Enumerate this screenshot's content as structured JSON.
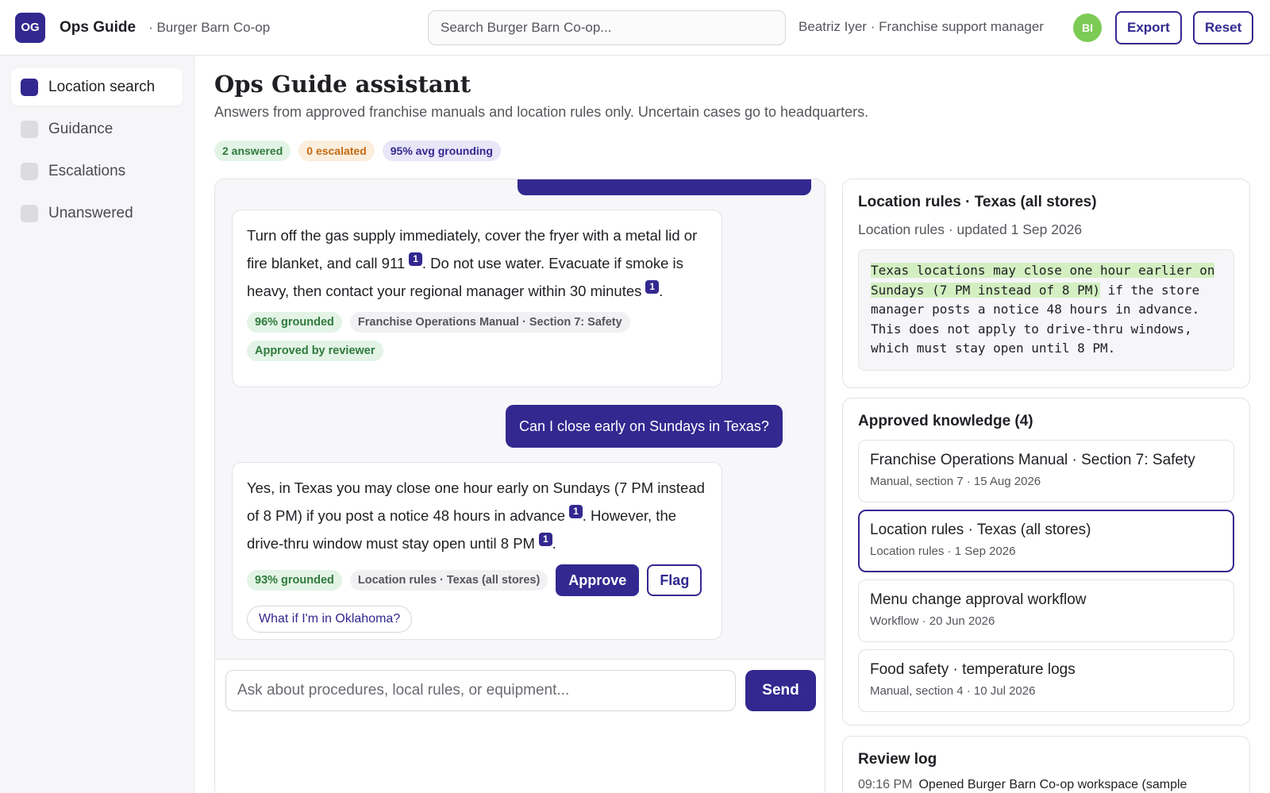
{
  "header": {
    "logo_text": "OG",
    "app_name": "Ops Guide",
    "org_name": "· Burger Barn Co-op",
    "search_placeholder": "Search Burger Barn Co-op...",
    "user_text": "Beatriz Iyer · Franchise support manager",
    "avatar_initials": "BI",
    "export_label": "Export",
    "reset_label": "Reset"
  },
  "sidebar": {
    "items": [
      {
        "label": "Location search",
        "active": true
      },
      {
        "label": "Guidance",
        "active": false
      },
      {
        "label": "Escalations",
        "active": false
      },
      {
        "label": "Unanswered",
        "active": false
      }
    ]
  },
  "main": {
    "title": "Ops Guide assistant",
    "subtitle": "Answers from approved franchise manuals and location rules only. Uncertain cases go to headquarters.",
    "stats": {
      "answered": "2 answered",
      "escalated": "0 escalated",
      "grounding": "95% avg grounding"
    }
  },
  "chat": {
    "answer1": {
      "part1": "Turn off the gas supply immediately, cover the fryer with a metal lid or fire blanket, and call 911",
      "cite1": "1",
      "part2": ". Do not use water. Evacuate if smoke is heavy, then contact your regional manager within 30 minutes",
      "cite2": "1",
      "part3": ".",
      "grounded": "96% grounded",
      "source": "Franchise Operations Manual · Section 7: Safety",
      "status": "Approved by reviewer"
    },
    "question2": "Can I close early on Sundays in Texas?",
    "answer2": {
      "part1": "Yes, in Texas you may close one hour early on Sundays (7 PM instead of 8 PM) if you post a notice 48 hours in advance",
      "cite1": "1",
      "part2": ". However, the drive-thru window must stay open until 8 PM",
      "cite2": "1",
      "part3": ".",
      "grounded": "93% grounded",
      "source": "Location rules · Texas (all stores)",
      "approve_label": "Approve",
      "flag_label": "Flag",
      "suggestion": "What if I'm in Oklahoma?"
    },
    "composer_placeholder": "Ask about procedures, local rules, or equipment...",
    "send_label": "Send"
  },
  "source_panel": {
    "title": "Location rules · Texas (all stores)",
    "subtitle": "Location rules · updated 1 Sep 2026",
    "highlight_text": "Texas locations may close one hour earlier on Sundays (7 PM instead of 8 PM)",
    "rest_text": " if the store manager posts a notice 48 hours in advance. This does not apply to drive-thru windows, which must stay open until 8 PM."
  },
  "knowledge": {
    "title": "Approved knowledge (4)",
    "items": [
      {
        "title": "Franchise Operations Manual · Section 7: Safety",
        "meta": "Manual, section 7 · 15 Aug 2026"
      },
      {
        "title": "Location rules · Texas (all stores)",
        "meta": "Location rules · 1 Sep 2026"
      },
      {
        "title": "Menu change approval workflow",
        "meta": "Workflow · 20 Jun 2026"
      },
      {
        "title": "Food safety · temperature logs",
        "meta": "Manual, section 4 · 10 Jul 2026"
      }
    ]
  },
  "review_log": {
    "title": "Review log",
    "entries": [
      {
        "time": "09:16 PM",
        "text": "Opened Burger Barn Co-op workspace (sample"
      }
    ]
  },
  "colors": {
    "accent": "#33288f",
    "avatar": "#7ccb55",
    "grounded_bg": "#e3f4e6",
    "highlight": "#d3efc1"
  }
}
